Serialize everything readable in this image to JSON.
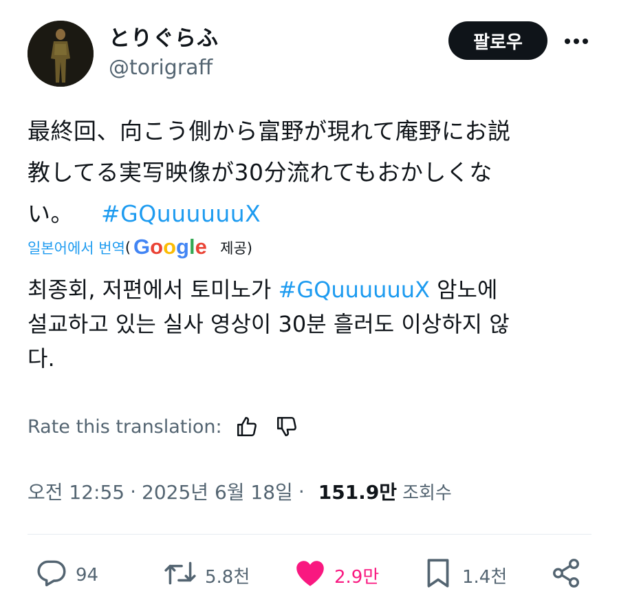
{
  "author": {
    "display_name": "とりぐらふ",
    "handle": "@torigraff"
  },
  "follow_button": "팔로우",
  "more_icon": "more-horizontal-icon",
  "tweet": {
    "line1": "最終回、向こう側から富野が現れて庵野にお説",
    "line2": "教してる実写映像が30分流れてもおかしくな",
    "line3_text": "い。",
    "line3_hashtag": "#GQuuuuuuX"
  },
  "translation": {
    "translated_from": "일본어에서 번역",
    "paren_open": "(",
    "provider": "Google",
    "provided": "제공)",
    "line1_a": "최종회, 저편에서 토미노가 ",
    "line1_hashtag": "#GQuuuuuuX",
    "line1_b": " 암노에",
    "line2": "설교하고 있는 실사 영상이 30분 흘러도 이상하지 않",
    "line3": "다."
  },
  "rate": {
    "label": "Rate this translation:",
    "thumbs_up_icon": "thumbs-up-icon",
    "thumbs_down_icon": "thumbs-down-icon"
  },
  "meta": {
    "time": "오전 12:55",
    "separator": "·",
    "date": "2025년 6월 18일",
    "views_count": "151.9만",
    "views_label": "조회수"
  },
  "actions": {
    "replies": "94",
    "reposts": "5.8천",
    "likes": "2.9만",
    "bookmarks": "1.4천"
  },
  "colors": {
    "link": "#1d9bf0",
    "like": "#f91880",
    "muted": "#536471",
    "text": "#0f1419"
  }
}
